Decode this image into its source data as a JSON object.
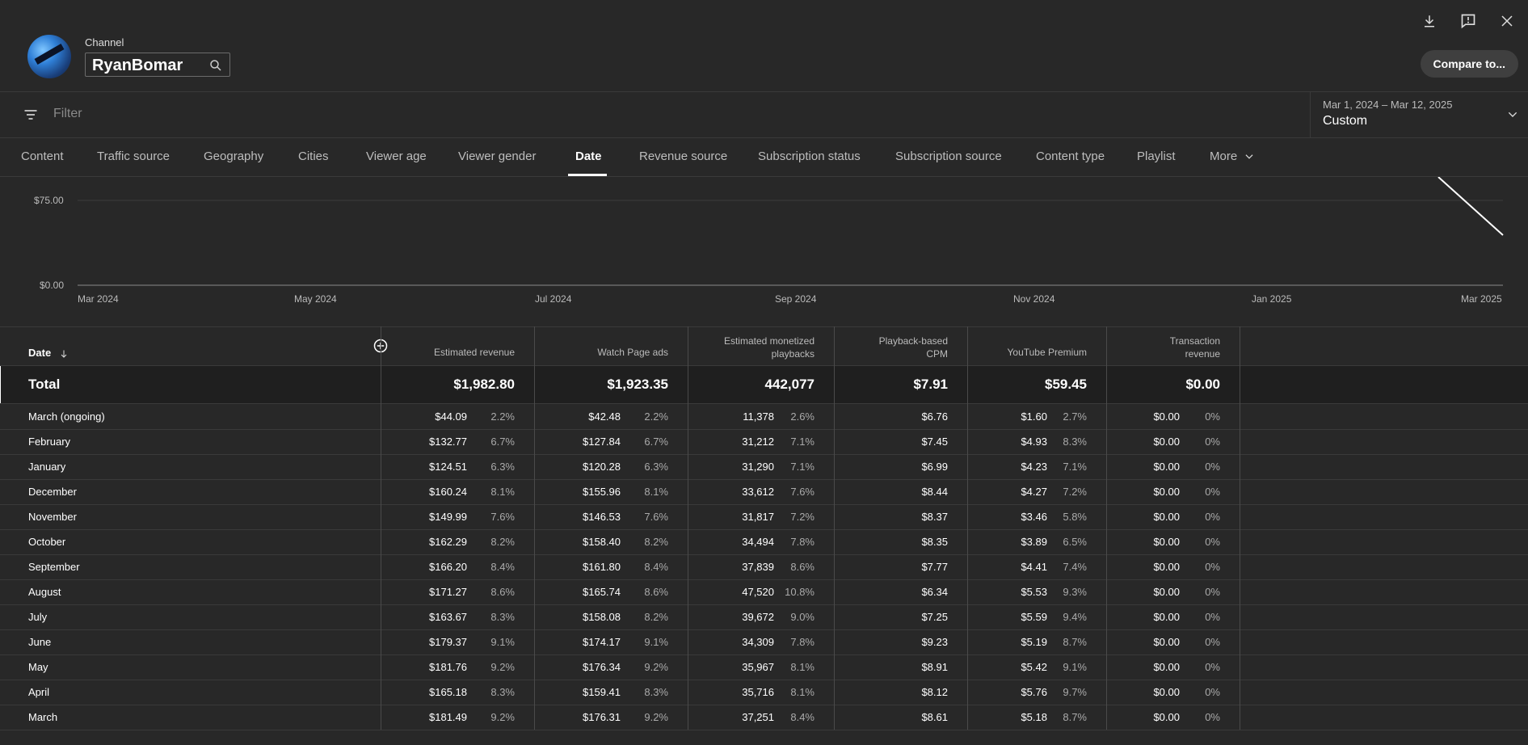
{
  "header": {
    "channel_label": "Channel",
    "channel_name": "RyanBomar",
    "compare_label": "Compare to..."
  },
  "filter": {
    "placeholder": "Filter",
    "date_range": "Mar 1, 2024 – Mar 12, 2025",
    "preset": "Custom"
  },
  "tabs": [
    {
      "label": "Content"
    },
    {
      "label": "Traffic source"
    },
    {
      "label": "Geography"
    },
    {
      "label": "Cities"
    },
    {
      "label": "Viewer age"
    },
    {
      "label": "Viewer gender"
    },
    {
      "label": "Date",
      "active": true
    },
    {
      "label": "Revenue source"
    },
    {
      "label": "Subscription status"
    },
    {
      "label": "Subscription source"
    },
    {
      "label": "Content type"
    },
    {
      "label": "Playlist"
    },
    {
      "label": "More"
    }
  ],
  "chart_data": {
    "type": "line",
    "y_ticks": [
      "$75.00",
      "$0.00"
    ],
    "x_ticks": [
      "Mar 2024",
      "May 2024",
      "Jul 2024",
      "Sep 2024",
      "Nov 2024",
      "Jan 2025",
      "Mar 2025"
    ],
    "series": [
      {
        "values": []
      }
    ]
  },
  "table": {
    "date_header": "Date",
    "columns": [
      "Estimated revenue",
      "Watch Page ads",
      "Estimated monetized playbacks",
      "Playback-based CPM",
      "YouTube Premium",
      "Transaction revenue"
    ],
    "column_lines": [
      [
        "Estimated revenue"
      ],
      [
        "Watch Page ads"
      ],
      [
        "Estimated monetized",
        "playbacks"
      ],
      [
        "Playback-based",
        "CPM"
      ],
      [
        "YouTube Premium"
      ],
      [
        "Transaction",
        "revenue"
      ]
    ],
    "total": {
      "label": "Total",
      "values": [
        "$1,982.80",
        "$1,923.35",
        "442,077",
        "$7.91",
        "$59.45",
        "$0.00"
      ]
    },
    "rows": [
      {
        "date": "March (ongoing)",
        "rev": "$44.09",
        "rev_pct": "2.2%",
        "wpa": "$42.48",
        "wpa_pct": "2.2%",
        "emp": "11,378",
        "emp_pct": "2.6%",
        "cpm": "$6.76",
        "yp": "$1.60",
        "yp_pct": "2.7%",
        "tr": "$0.00",
        "tr_pct": "0%"
      },
      {
        "date": "February",
        "rev": "$132.77",
        "rev_pct": "6.7%",
        "wpa": "$127.84",
        "wpa_pct": "6.7%",
        "emp": "31,212",
        "emp_pct": "7.1%",
        "cpm": "$7.45",
        "yp": "$4.93",
        "yp_pct": "8.3%",
        "tr": "$0.00",
        "tr_pct": "0%"
      },
      {
        "date": "January",
        "rev": "$124.51",
        "rev_pct": "6.3%",
        "wpa": "$120.28",
        "wpa_pct": "6.3%",
        "emp": "31,290",
        "emp_pct": "7.1%",
        "cpm": "$6.99",
        "yp": "$4.23",
        "yp_pct": "7.1%",
        "tr": "$0.00",
        "tr_pct": "0%"
      },
      {
        "date": "December",
        "rev": "$160.24",
        "rev_pct": "8.1%",
        "wpa": "$155.96",
        "wpa_pct": "8.1%",
        "emp": "33,612",
        "emp_pct": "7.6%",
        "cpm": "$8.44",
        "yp": "$4.27",
        "yp_pct": "7.2%",
        "tr": "$0.00",
        "tr_pct": "0%"
      },
      {
        "date": "November",
        "rev": "$149.99",
        "rev_pct": "7.6%",
        "wpa": "$146.53",
        "wpa_pct": "7.6%",
        "emp": "31,817",
        "emp_pct": "7.2%",
        "cpm": "$8.37",
        "yp": "$3.46",
        "yp_pct": "5.8%",
        "tr": "$0.00",
        "tr_pct": "0%"
      },
      {
        "date": "October",
        "rev": "$162.29",
        "rev_pct": "8.2%",
        "wpa": "$158.40",
        "wpa_pct": "8.2%",
        "emp": "34,494",
        "emp_pct": "7.8%",
        "cpm": "$8.35",
        "yp": "$3.89",
        "yp_pct": "6.5%",
        "tr": "$0.00",
        "tr_pct": "0%"
      },
      {
        "date": "September",
        "rev": "$166.20",
        "rev_pct": "8.4%",
        "wpa": "$161.80",
        "wpa_pct": "8.4%",
        "emp": "37,839",
        "emp_pct": "8.6%",
        "cpm": "$7.77",
        "yp": "$4.41",
        "yp_pct": "7.4%",
        "tr": "$0.00",
        "tr_pct": "0%"
      },
      {
        "date": "August",
        "rev": "$171.27",
        "rev_pct": "8.6%",
        "wpa": "$165.74",
        "wpa_pct": "8.6%",
        "emp": "47,520",
        "emp_pct": "10.8%",
        "cpm": "$6.34",
        "yp": "$5.53",
        "yp_pct": "9.3%",
        "tr": "$0.00",
        "tr_pct": "0%"
      },
      {
        "date": "July",
        "rev": "$163.67",
        "rev_pct": "8.3%",
        "wpa": "$158.08",
        "wpa_pct": "8.2%",
        "emp": "39,672",
        "emp_pct": "9.0%",
        "cpm": "$7.25",
        "yp": "$5.59",
        "yp_pct": "9.4%",
        "tr": "$0.00",
        "tr_pct": "0%"
      },
      {
        "date": "June",
        "rev": "$179.37",
        "rev_pct": "9.1%",
        "wpa": "$174.17",
        "wpa_pct": "9.1%",
        "emp": "34,309",
        "emp_pct": "7.8%",
        "cpm": "$9.23",
        "yp": "$5.19",
        "yp_pct": "8.7%",
        "tr": "$0.00",
        "tr_pct": "0%"
      },
      {
        "date": "May",
        "rev": "$181.76",
        "rev_pct": "9.2%",
        "wpa": "$176.34",
        "wpa_pct": "9.2%",
        "emp": "35,967",
        "emp_pct": "8.1%",
        "cpm": "$8.91",
        "yp": "$5.42",
        "yp_pct": "9.1%",
        "tr": "$0.00",
        "tr_pct": "0%"
      },
      {
        "date": "April",
        "rev": "$165.18",
        "rev_pct": "8.3%",
        "wpa": "$159.41",
        "wpa_pct": "8.3%",
        "emp": "35,716",
        "emp_pct": "8.1%",
        "cpm": "$8.12",
        "yp": "$5.76",
        "yp_pct": "9.7%",
        "tr": "$0.00",
        "tr_pct": "0%"
      },
      {
        "date": "March",
        "rev": "$181.49",
        "rev_pct": "9.2%",
        "wpa": "$176.31",
        "wpa_pct": "9.2%",
        "emp": "37,251",
        "emp_pct": "8.4%",
        "cpm": "$8.61",
        "yp": "$5.18",
        "yp_pct": "8.7%",
        "tr": "$0.00",
        "tr_pct": "0%"
      }
    ]
  }
}
